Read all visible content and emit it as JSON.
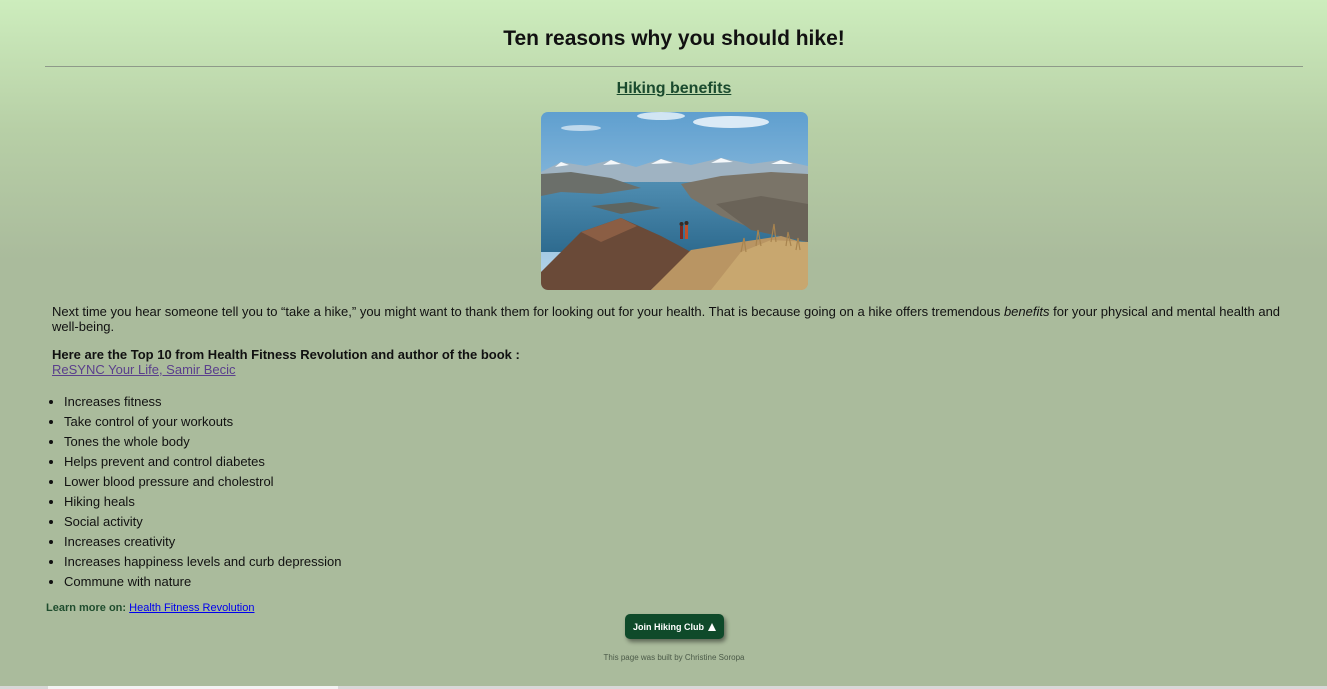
{
  "page": {
    "title": "Ten reasons why you should hike!",
    "subtitle_link": "Hiking benefits"
  },
  "hero": {
    "alt": "Two hikers on a ridge overlooking a mountain lake",
    "icon": "landscape-photo"
  },
  "intro": {
    "before": "Next time you hear someone tell you to “take a hike,” you might want to thank them for looking out for your health. That is because going on a hike offers tremendous ",
    "emphasis": "benefits",
    "after": " for your physical and mental health and well-being."
  },
  "top_list": {
    "lead": "Here are the Top 10 from Health Fitness Revolution and author of the book :",
    "book_link": "ReSYNC Your Life, Samir Becic"
  },
  "reasons": [
    "Increases fitness",
    "Take control of your workouts",
    "Tones the whole body",
    "Helps prevent and control diabetes",
    "Lower blood pressure and cholestrol",
    "Hiking heals",
    "Social activity",
    "Increases creativity",
    "Increases happiness levels and curb depression",
    "Commune with nature"
  ],
  "learn_more": {
    "label": "Learn more on:",
    "link": "Health Fitness Revolution"
  },
  "join_button": {
    "label": "Join Hiking Club",
    "icon": "tree-triangle-icon"
  },
  "footer": {
    "text": "This page was built by Christine Soropa"
  },
  "colors": {
    "button_bg": "#0f4a2a",
    "link_dark_green": "#1a4a2e",
    "visited_link": "#5a3f8c",
    "link_blue": "#0000ee"
  }
}
